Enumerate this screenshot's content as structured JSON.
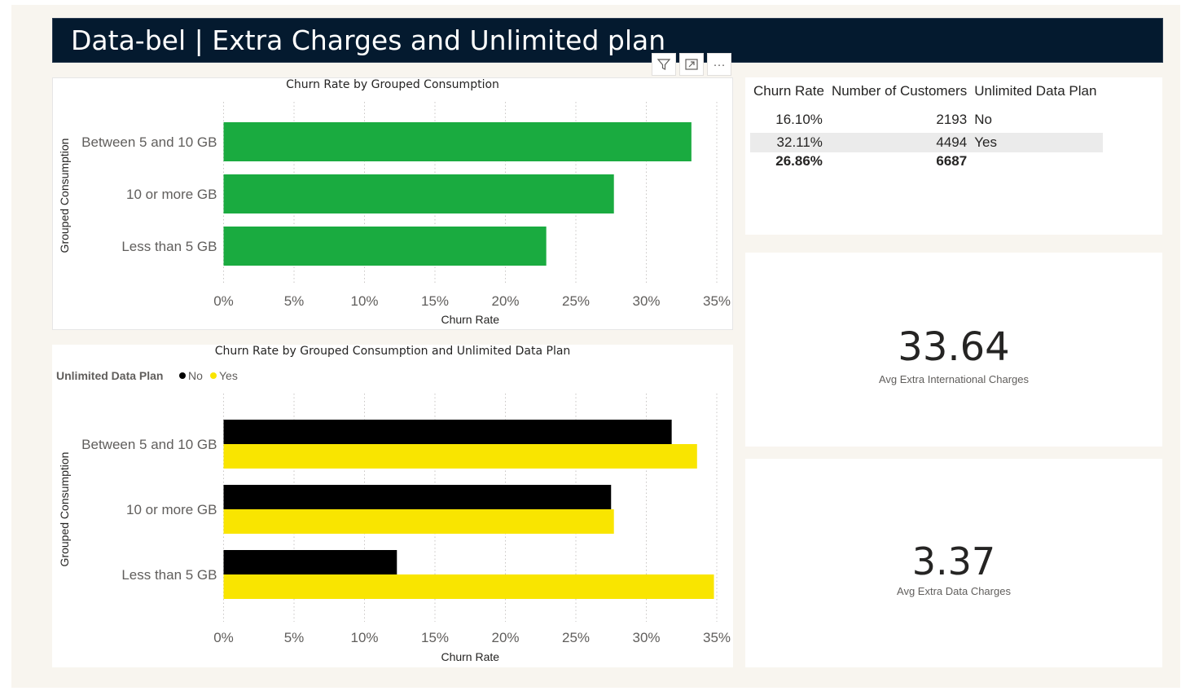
{
  "report": {
    "title": "Data-bel | Extra Charges and Unlimited plan"
  },
  "visual_header": {
    "filter_icon": "filter-icon",
    "focus_icon": "focus-mode-icon",
    "more_icon": "more-options-icon",
    "more_glyph": "···"
  },
  "colors": {
    "title_bg": "#041a2f",
    "green": "#1aab40",
    "black": "#000000",
    "yellow": "#f9e500",
    "canvas": "#f8f5ef"
  },
  "chart_data": [
    {
      "type": "bar",
      "orientation": "horizontal",
      "title": "Churn Rate by Grouped Consumption",
      "xlabel": "Churn Rate",
      "ylabel": "Grouped Consumption",
      "categories": [
        "Between 5 and 10 GB",
        "10 or more GB",
        "Less than 5 GB"
      ],
      "values": [
        33.2,
        27.7,
        22.9
      ],
      "value_unit": "%",
      "xlim": [
        0,
        35
      ],
      "xticks": [
        "0%",
        "5%",
        "10%",
        "15%",
        "20%",
        "25%",
        "30%",
        "35%"
      ],
      "grid": "vertical dotted",
      "color": "#1aab40"
    },
    {
      "type": "bar",
      "orientation": "horizontal",
      "title": "Churn Rate by Grouped Consumption and Unlimited Data Plan",
      "xlabel": "Churn Rate",
      "ylabel": "Grouped Consumption",
      "legend_title": "Unlimited Data Plan",
      "legend_position": "top-left",
      "categories": [
        "Between 5 and 10 GB",
        "10 or more GB",
        "Less than 5 GB"
      ],
      "series": [
        {
          "name": "No",
          "color": "#000000",
          "values": [
            31.8,
            27.5,
            12.3
          ]
        },
        {
          "name": "Yes",
          "color": "#f9e500",
          "values": [
            33.6,
            27.7,
            34.8
          ]
        }
      ],
      "value_unit": "%",
      "xlim": [
        0,
        35
      ],
      "xticks": [
        "0%",
        "5%",
        "10%",
        "15%",
        "20%",
        "25%",
        "30%",
        "35%"
      ],
      "grid": "vertical dotted"
    }
  ],
  "table": {
    "headers": [
      "Churn Rate",
      "Number of Customers",
      "Unlimited Data Plan"
    ],
    "rows": [
      [
        "16.10%",
        "2193",
        "No"
      ],
      [
        "32.11%",
        "4494",
        "Yes"
      ]
    ],
    "total": [
      "26.86%",
      "6687",
      ""
    ]
  },
  "kpis": [
    {
      "value": "33.64",
      "label": "Avg Extra International Charges"
    },
    {
      "value": "3.37",
      "label": "Avg Extra Data Charges"
    }
  ]
}
